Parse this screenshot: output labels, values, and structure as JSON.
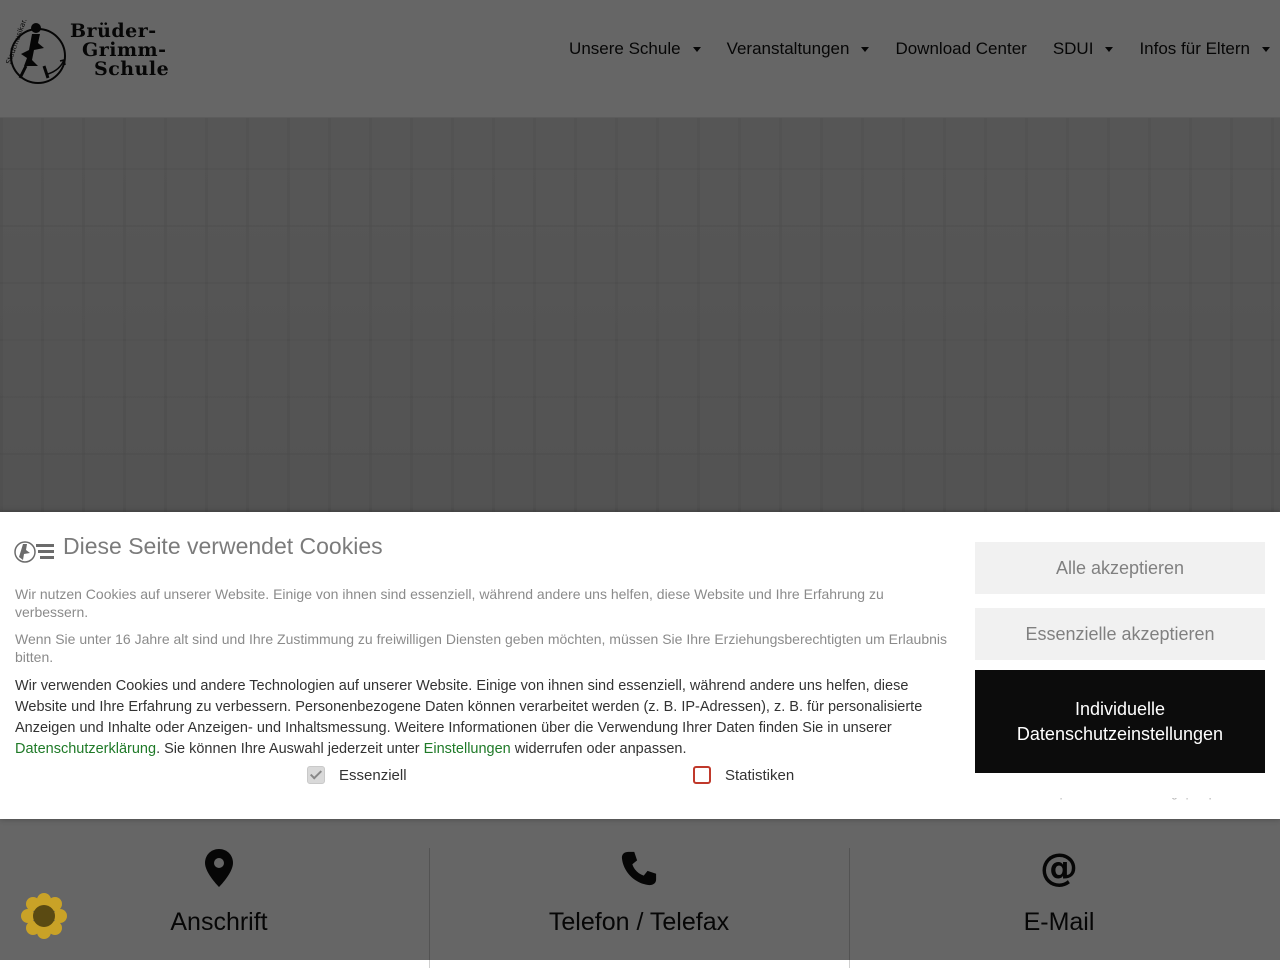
{
  "logo": {
    "line1": "Brüder-",
    "line2": "Grimm-",
    "line3": "Schule"
  },
  "nav": [
    {
      "label": "Unsere Schule",
      "dropdown": true
    },
    {
      "label": "Veranstaltungen",
      "dropdown": true
    },
    {
      "label": "Download Center",
      "dropdown": false
    },
    {
      "label": "SDUI",
      "dropdown": true
    },
    {
      "label": "Infos für Eltern",
      "dropdown": true
    }
  ],
  "contact": {
    "address_title": "Anschrift",
    "phone_title": "Telefon / Telefax",
    "email_title": "E-Mail",
    "icons": [
      "map-pin-icon",
      "phone-icon",
      "at-icon"
    ]
  },
  "cookie": {
    "headline": "Diese Seite verwendet Cookies",
    "intro": "Wir nutzen Cookies auf unserer Website. Einige von ihnen sind essenziell, während andere uns helfen, diese Website und Ihre Erfahrung zu verbessern.",
    "age_notice": "Wenn Sie unter 16 Jahre alt sind und Ihre Zustimmung zu freiwilligen Diensten geben möchten, müssen Sie Ihre Erziehungsberechtigten um Erlaubnis bitten.",
    "details_text_1": "Wir verwenden Cookies und andere Technologien auf unserer Website. Einige von ihnen sind essenziell, während andere uns helfen, diese Website und Ihre Erfahrung zu verbessern. Personenbezogene Daten können verarbeitet werden (z. B. IP-Adressen), z. B. für personalisierte Anzeigen und Inhalte oder Anzeigen- und Inhaltsmessung. Weitere Informationen über die Verwendung Ihrer Daten finden Sie in unserer ",
    "privacy_link": "Datenschutzerklärung",
    "details_text_2": ". Sie können Ihre Auswahl jederzeit unter ",
    "settings_link": "Einstellungen",
    "details_text_3": " widerrufen oder anpassen.",
    "checkbox_essential": {
      "label": "Essenziell",
      "checked": true
    },
    "checkbox_stats": {
      "label": "Statistiken",
      "checked": false
    },
    "btn_accept_all": "Alle akzeptieren",
    "btn_accept_essential": "Essenzielle akzeptieren",
    "btn_individual": "Individuelle Datenschutzeinstellungen",
    "footer_links": [
      "Cookie-Details",
      "Datenschutzerklärung",
      "Impressum"
    ],
    "footer_sep": "|"
  },
  "colors": {
    "link_green": "#1f7a28",
    "dark_button": "#0c0c0c",
    "badge": "#c9a227",
    "unchecked_red": "#c0392b"
  }
}
